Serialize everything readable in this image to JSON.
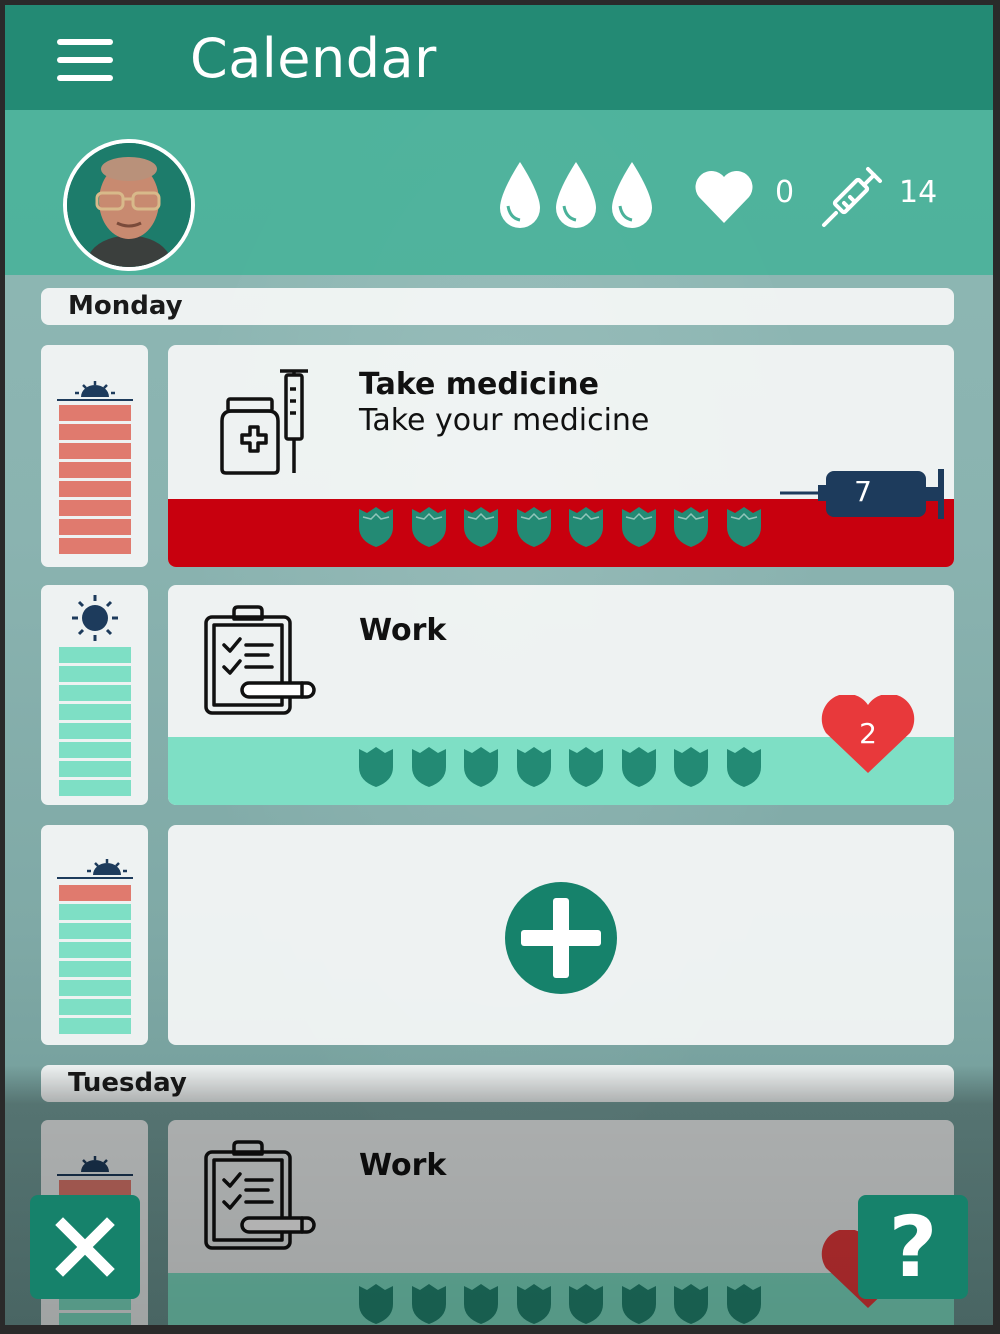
{
  "header": {
    "title": "Calendar"
  },
  "status": {
    "drops": 3,
    "hearts": "0",
    "syringes": "14"
  },
  "days": [
    {
      "label": "Monday",
      "slots": [
        {
          "time_icon": "sunrise-icon",
          "title": "Take medicine",
          "subtitle": "Take your medicine",
          "icon": "medicine-icon",
          "strip_color": "#c8000e",
          "badge_value": "7",
          "badge_icon": "syringe-icon",
          "shield_count": 8
        },
        {
          "time_icon": "sun-icon",
          "title": "Work",
          "subtitle": "",
          "icon": "clipboard-icon",
          "strip_color": "#7edfc5",
          "badge_value": "2",
          "badge_icon": "heart-icon",
          "shield_count": 8
        },
        {
          "time_icon": "sunset-icon",
          "add_button": "add-activity-button"
        }
      ]
    },
    {
      "label": "Tuesday",
      "slots": [
        {
          "time_icon": "sunrise-icon",
          "title": "Work",
          "subtitle": "",
          "icon": "clipboard-icon",
          "strip_color": "#7edfc5",
          "shield_count": 8
        }
      ]
    }
  ],
  "buttons": {
    "close": "close-icon",
    "help": "?"
  },
  "colors": {
    "header": "#238a74",
    "status_bar": "#4ab29a",
    "shield": "#238a74",
    "bar_red": "#e07a6e",
    "bar_green": "#7edfc5",
    "dark_blue": "#1d3b5c",
    "heart_red": "#e8393b"
  }
}
